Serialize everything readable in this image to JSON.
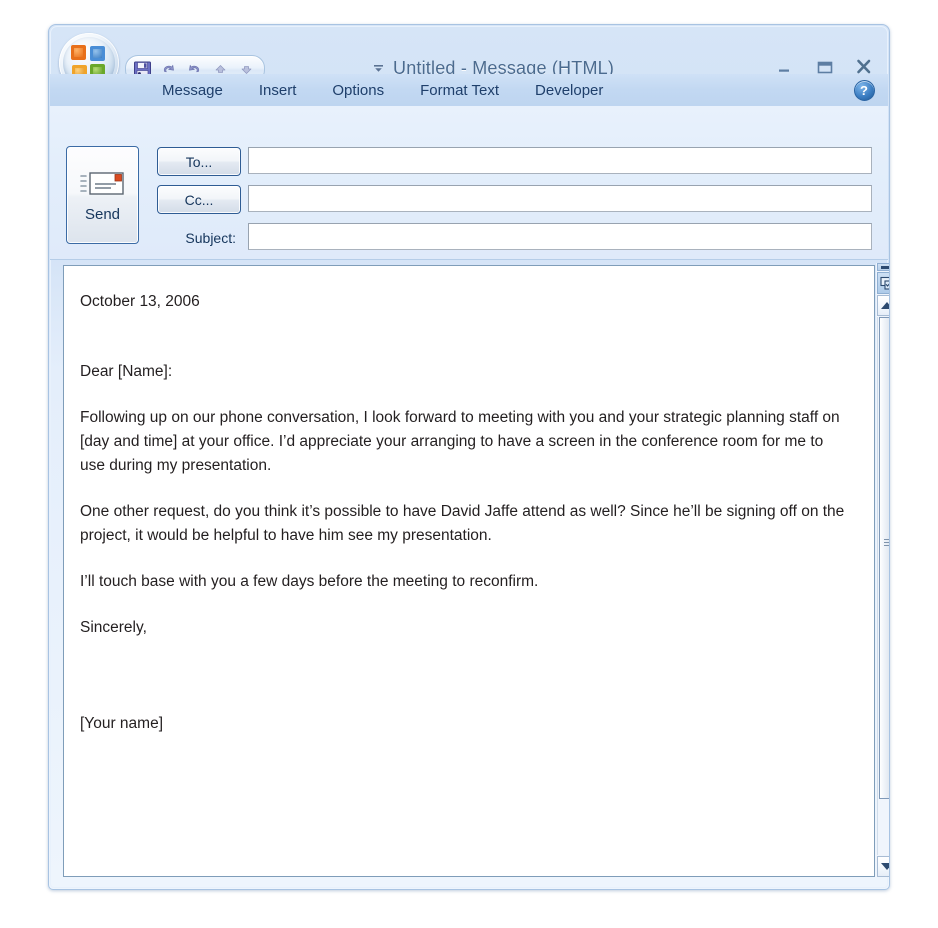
{
  "window": {
    "title": "Untitled - Message (HTML)",
    "accent_color": "#4b6b8f",
    "chrome_color": "#cfe1f6"
  },
  "titlebar": {
    "office_button": "office-orb",
    "quick_access": [
      {
        "name": "save",
        "label": "Save",
        "icon": "floppy-disk-icon"
      },
      {
        "name": "undo",
        "label": "Undo",
        "icon": "undo-arrow-icon"
      },
      {
        "name": "redo",
        "label": "Redo",
        "icon": "redo-arrow-icon"
      },
      {
        "name": "previous-item",
        "label": "Previous Item",
        "icon": "up-arrow-icon"
      },
      {
        "name": "next-item",
        "label": "Next Item",
        "icon": "down-arrow-icon"
      }
    ],
    "customize_dropdown": "chevron-down-icon",
    "controls": [
      {
        "name": "minimize",
        "label": "Minimize",
        "glyph": "_"
      },
      {
        "name": "maximize",
        "label": "Maximize",
        "glyph": "▭"
      },
      {
        "name": "close",
        "label": "Close",
        "glyph": "✕"
      }
    ]
  },
  "ribbon": {
    "tabs": [
      {
        "label": "Message"
      },
      {
        "label": "Insert"
      },
      {
        "label": "Options"
      },
      {
        "label": "Format Text"
      },
      {
        "label": "Developer"
      }
    ],
    "active_tab": "Message",
    "help_glyph": "?"
  },
  "compose": {
    "send_label": "Send",
    "to_label": "To...",
    "cc_label": "Cc...",
    "subject_label": "Subject:",
    "to_value": "",
    "cc_value": "",
    "subject_value": ""
  },
  "message_body": {
    "date": "October 13, 2006",
    "salutation": "Dear [Name]:",
    "paragraph1": "Following up on our phone conversation, I look forward to meeting with you and your strategic planning staff on [day and time] at your office. I’d appreciate your arranging to have a screen in the conference room for me to use during my presentation.",
    "paragraph2": "One other request, do you think it’s possible to have David Jaffe attend as well? Since he’ll be signing off on the project, it would be helpful to have him see my presentation.",
    "paragraph3": "I’ll touch base with you a few days before the meeting to reconfirm.",
    "closing": "Sincerely,",
    "signature": "[Your name]"
  },
  "scrollbar": {
    "split_handle": "split-bar-handle",
    "browse_object": "select-browse-object-icon",
    "scroll_up": "scroll-up-arrow-icon",
    "scroll_down": "scroll-down-arrow-icon",
    "thumb": "scroll-thumb"
  }
}
